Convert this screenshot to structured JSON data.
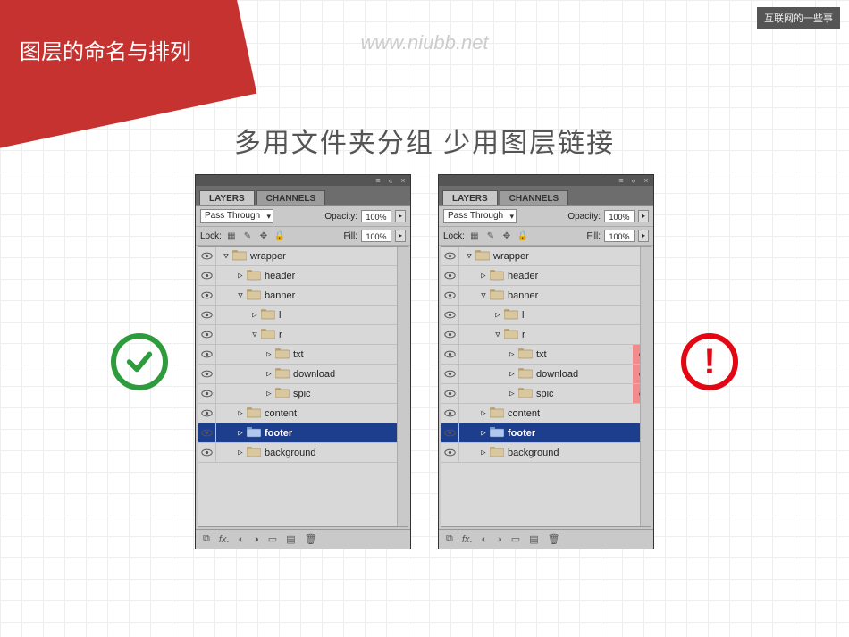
{
  "watermark": "www.niubb.net",
  "top_badge": "互联网的一些事",
  "red_title": "图层的命名与排列",
  "subtitle": "多用文件夹分组  少用图层链接",
  "panel": {
    "tabs": {
      "layers": "LAYERS",
      "channels": "CHANNELS"
    },
    "blend_mode": "Pass Through",
    "opacity_label": "Opacity:",
    "opacity_value": "100%",
    "lock_label": "Lock:",
    "fill_label": "Fill:",
    "fill_value": "100%"
  },
  "tree": [
    {
      "name": "wrapper",
      "depth": 0,
      "open": true,
      "selected": false
    },
    {
      "name": "header",
      "depth": 1,
      "open": false,
      "selected": false
    },
    {
      "name": "banner",
      "depth": 1,
      "open": true,
      "selected": false
    },
    {
      "name": "l",
      "depth": 2,
      "open": false,
      "selected": false
    },
    {
      "name": "r",
      "depth": 2,
      "open": true,
      "selected": false
    },
    {
      "name": "txt",
      "depth": 3,
      "open": false,
      "selected": false,
      "linkable": true
    },
    {
      "name": "download",
      "depth": 3,
      "open": false,
      "selected": false,
      "linkable": true
    },
    {
      "name": "spic",
      "depth": 3,
      "open": false,
      "selected": false,
      "linkable": true
    },
    {
      "name": "content",
      "depth": 1,
      "open": false,
      "selected": false
    },
    {
      "name": "footer",
      "depth": 1,
      "open": false,
      "selected": true
    },
    {
      "name": "background",
      "depth": 1,
      "open": false,
      "selected": false
    }
  ],
  "status": {
    "good": "✓",
    "bad": "!"
  }
}
